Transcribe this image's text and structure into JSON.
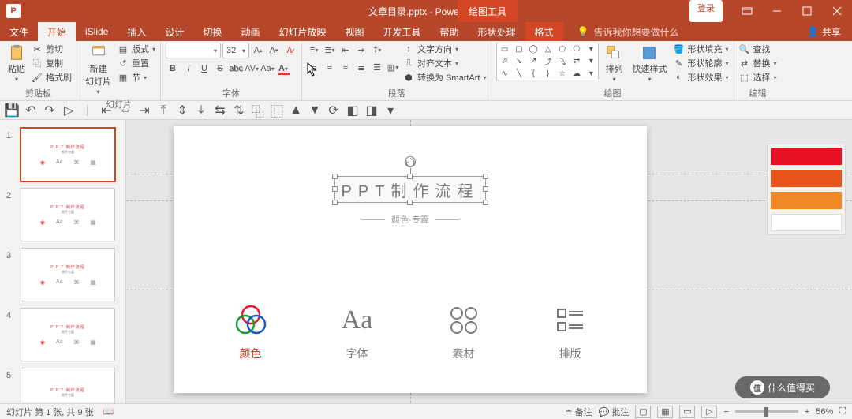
{
  "app": {
    "title": "文章目录.pptx  -  PowerPoint",
    "context_tool": "绘图工具",
    "login": "登录"
  },
  "tabs": {
    "file": "文件",
    "home": "开始",
    "islide": "iSlide",
    "insert": "插入",
    "design": "设计",
    "transition": "切换",
    "animation": "动画",
    "slideshow": "幻灯片放映",
    "view": "视图",
    "dev": "开发工具",
    "help": "帮助",
    "shapeproc": "形状处理",
    "format": "格式",
    "tellme": "告诉我你想要做什么",
    "share": "共享"
  },
  "ribbon": {
    "clipboard": {
      "label": "剪贴板",
      "paste": "粘贴",
      "cut": "剪切",
      "copy": "复制",
      "painter": "格式刷"
    },
    "slides": {
      "label": "幻灯片",
      "new": "新建\n幻灯片",
      "layout": "版式",
      "reset": "重置",
      "section": "节"
    },
    "font": {
      "label": "字体",
      "name": "",
      "size": "32"
    },
    "para": {
      "label": "段落",
      "textdir": "文字方向",
      "align": "对齐文本",
      "smartart": "转换为 SmartArt"
    },
    "drawing": {
      "label": "绘图",
      "arrange": "排列",
      "quickstyle": "快速样式",
      "fill": "形状填充",
      "outline": "形状轮廓",
      "effects": "形状效果"
    },
    "editing": {
      "label": "编辑",
      "find": "查找",
      "replace": "替换",
      "select": "选择"
    }
  },
  "slide": {
    "title": "PPT制作流程",
    "subtitle": "颜色·专篇",
    "features": [
      "颜色",
      "字体",
      "素材",
      "排版"
    ]
  },
  "palette": [
    "#e81123",
    "#e8551b",
    "#f08722",
    "#ffffff"
  ],
  "status": {
    "left": "幻灯片 第 1 张, 共 9 张",
    "notes": "备注",
    "comments": "批注",
    "zoom": "56%"
  },
  "watermark": "什么值得买",
  "thumbs": [
    1,
    2,
    3,
    4,
    5
  ]
}
